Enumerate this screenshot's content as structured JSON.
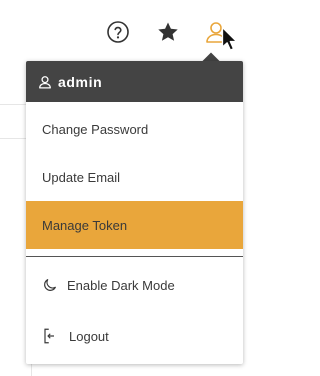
{
  "topbar": {
    "help_icon": "help-circle-icon",
    "favorites_icon": "star-icon",
    "user_icon": "user-icon"
  },
  "menu": {
    "header_label": "admin",
    "items": [
      {
        "label": "Change Password"
      },
      {
        "label": "Update Email"
      },
      {
        "label": "Manage Token",
        "active": true
      }
    ],
    "dark_mode_label": "Enable Dark Mode",
    "logout_label": "Logout"
  },
  "colors": {
    "header_bg": "#444444",
    "active_bg": "#e9a63b",
    "user_icon_accent": "#e9a63b"
  }
}
